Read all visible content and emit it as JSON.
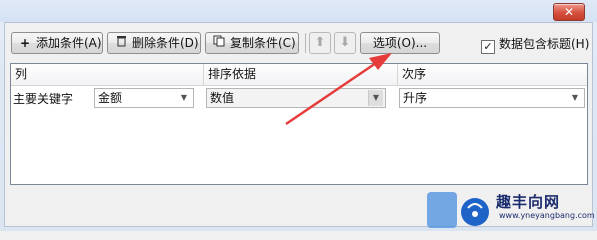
{
  "toolbar": {
    "add_label": "添加条件(A)",
    "delete_label": "删除条件(D)",
    "copy_label": "复制条件(C)",
    "options_label": "选项(O)...",
    "header_checkbox_label": "数据包含标题(H)",
    "header_checkbox_checked": true
  },
  "grid": {
    "headers": [
      "列",
      "排序依据",
      "次序"
    ],
    "rows": [
      {
        "label": "主要关键字",
        "column": "金额",
        "sort_on": "数值",
        "order": "升序"
      }
    ]
  },
  "watermark": {
    "brand": "趣丰向网",
    "url": "www.yneyangbang.com"
  },
  "colors": {
    "close_button": "#d5503e",
    "annotation_arrow": "#e53b3b"
  }
}
